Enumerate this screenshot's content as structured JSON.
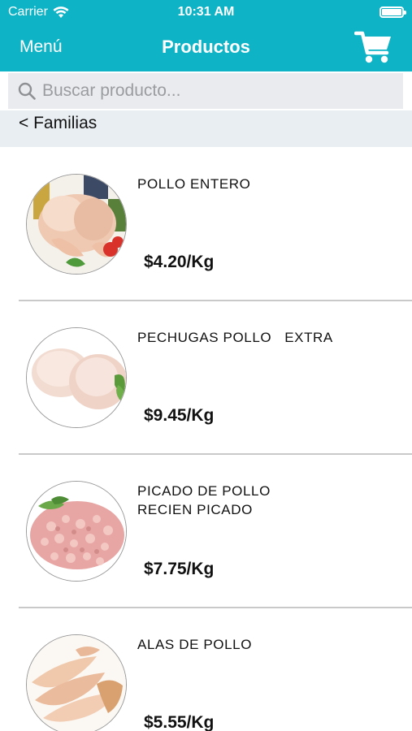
{
  "status_bar": {
    "carrier": "Carrier",
    "time": "10:31 AM",
    "icons": [
      "wifi-icon",
      "battery-icon"
    ]
  },
  "nav": {
    "menu_label": "Menú",
    "title": "Productos",
    "cart_icon": "shopping-cart-icon"
  },
  "search": {
    "placeholder": "Buscar producto...",
    "value": ""
  },
  "breadcrumb": {
    "back_label": "< Familias"
  },
  "products": [
    {
      "name": "POLLO ENTERO",
      "price": "$4.20/Kg",
      "image": "whole-chicken"
    },
    {
      "name": "PECHUGAS POLLO   EXTRA",
      "price": "$9.45/Kg",
      "image": "chicken-breasts"
    },
    {
      "name": "PICADO DE POLLO\nRECIEN PICADO",
      "price": "$7.75/Kg",
      "image": "minced-chicken"
    },
    {
      "name": "ALAS DE POLLO",
      "price": "$5.55/Kg",
      "image": "chicken-wings"
    }
  ],
  "colors": {
    "header": "#0fb3c6",
    "search_bg": "#e9ebee",
    "families_bg": "#e9eef3",
    "separator": "#c9c9c9"
  }
}
